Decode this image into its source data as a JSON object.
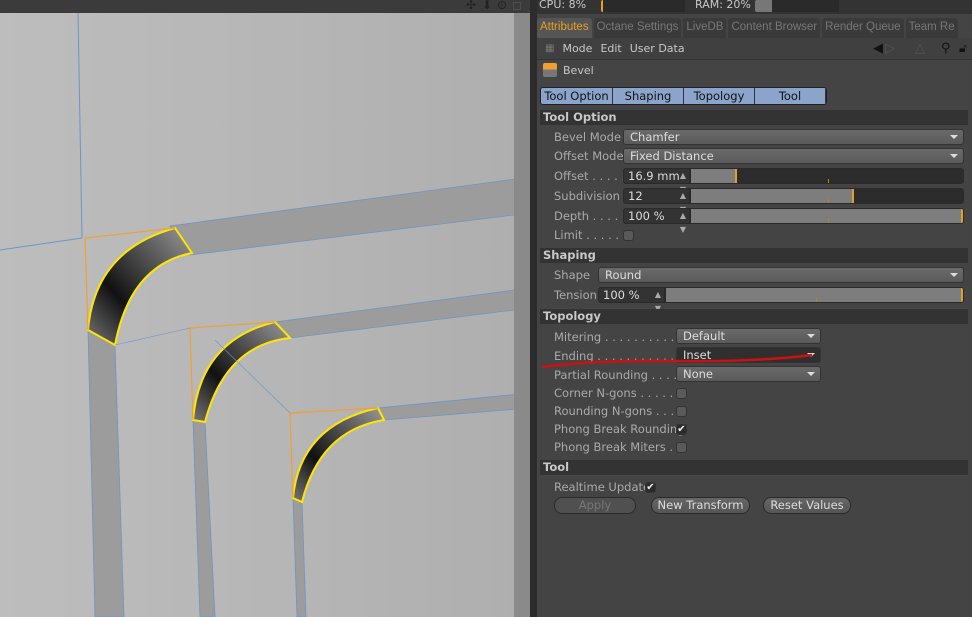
{
  "viewport": {
    "icons": [
      "move-view-icon",
      "pan-down-icon",
      "rotate-view-icon",
      "maximize-view-icon"
    ],
    "object_name": "Bevel"
  },
  "status": {
    "cpu": "CPU: 8%",
    "ram": "RAM: 20%",
    "cpu_fraction": 0.0,
    "ram_fraction": 0.2
  },
  "tabs": [
    "Attributes",
    "Octane Settings",
    "LiveDB",
    "Content Browser",
    "Render Queue",
    "Team Re"
  ],
  "menu": {
    "items": [
      "Mode",
      "Edit",
      "User Data"
    ]
  },
  "object": {
    "name": "Bevel"
  },
  "page_tabs": [
    "Tool Option",
    "Shaping",
    "Topology",
    "Tool"
  ],
  "tool_option": {
    "title": "Tool Option",
    "bevel_mode": {
      "label": "Bevel Mode",
      "value": "Chamfer"
    },
    "offset_mode": {
      "label": "Offset Mode",
      "value": "Fixed Distance"
    },
    "offset": {
      "label": "Offset . . . . .",
      "value": "16.9 mm",
      "fraction": 0.17
    },
    "subdivision": {
      "label": "Subdivision",
      "value": "12",
      "fraction": 0.6
    },
    "depth": {
      "label": "Depth . . . . .",
      "value": "100 %",
      "fraction": 1.0
    },
    "limit": {
      "label": "Limit . . . . . .",
      "checked": false
    }
  },
  "shaping": {
    "title": "Shaping",
    "shape": {
      "label": "Shape",
      "value": "Round"
    },
    "tension": {
      "label": "Tension",
      "value": "100 %",
      "fraction": 1.0
    }
  },
  "topology": {
    "title": "Topology",
    "mitering": {
      "label": "Mitering . . . . . . . . . . . .",
      "value": "Default"
    },
    "ending": {
      "label": "Ending . . . . . . . . . . . . .",
      "value": "Inset"
    },
    "partial_rounding": {
      "label": "Partial Rounding . . . . .",
      "value": "None"
    },
    "corner_ngons": {
      "label": "Corner N-gons . . . . . .",
      "checked": false
    },
    "rounding_ngons": {
      "label": "Rounding N-gons . . . .",
      "checked": false
    },
    "phong_break_rounding": {
      "label": "Phong Break Rounding",
      "checked": true
    },
    "phong_break_miters": {
      "label": "Phong Break Miters . .",
      "checked": false
    }
  },
  "tool": {
    "title": "Tool",
    "realtime_update": {
      "label": "Realtime Update",
      "checked": true
    },
    "apply": "Apply",
    "new_transform": "New Transform",
    "reset_values": "Reset Values"
  },
  "colors": {
    "accent": "#e0a020",
    "tab_blue": "#8ba4cc",
    "selection": "#ffe600",
    "annotation": "#cc1111"
  },
  "check_glyph": "✔"
}
